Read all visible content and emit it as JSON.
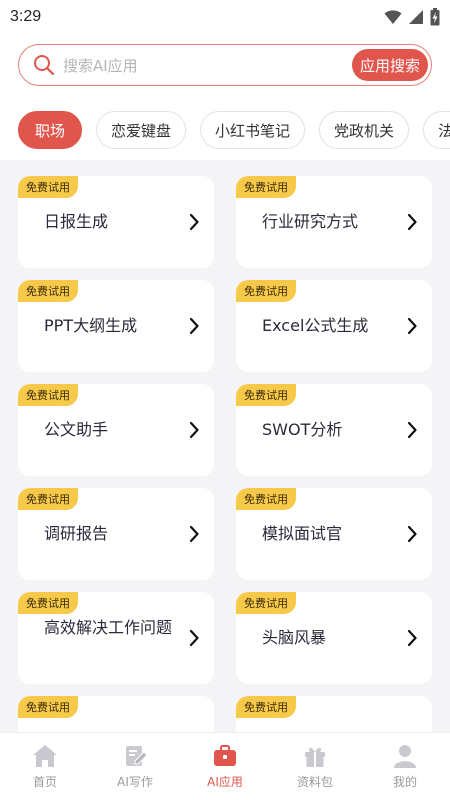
{
  "status": {
    "time": "3:29"
  },
  "search": {
    "placeholder": "搜索AI应用",
    "button_label": "应用搜索"
  },
  "categories": [
    "职场",
    "恋爱键盘",
    "小红书笔记",
    "党政机关",
    "法"
  ],
  "cards": [
    {
      "badge": "免费试用",
      "title": "日报生成"
    },
    {
      "badge": "免费试用",
      "title": "行业研究方式"
    },
    {
      "badge": "免费试用",
      "title": "PPT大纲生成"
    },
    {
      "badge": "免费试用",
      "title": "Excel公式生成"
    },
    {
      "badge": "免费试用",
      "title": "公文助手"
    },
    {
      "badge": "免费试用",
      "title": "SWOT分析"
    },
    {
      "badge": "免费试用",
      "title": "调研报告"
    },
    {
      "badge": "免费试用",
      "title": "模拟面试官"
    },
    {
      "badge": "免费试用",
      "title": "高效解决工作问题"
    },
    {
      "badge": "免费试用",
      "title": "头脑风暴"
    },
    {
      "badge": "免费试用",
      "title": ""
    },
    {
      "badge": "免费试用",
      "title": ""
    }
  ],
  "nav": [
    {
      "label": "首页",
      "icon": "home-icon"
    },
    {
      "label": "AI写作",
      "icon": "write-icon"
    },
    {
      "label": "AI应用",
      "icon": "briefcase-icon"
    },
    {
      "label": "资料包",
      "icon": "gift-icon"
    },
    {
      "label": "我的",
      "icon": "user-icon"
    }
  ],
  "colors": {
    "accent": "#e0564d",
    "badge": "#f7c94b",
    "background": "#f4f4f6"
  }
}
